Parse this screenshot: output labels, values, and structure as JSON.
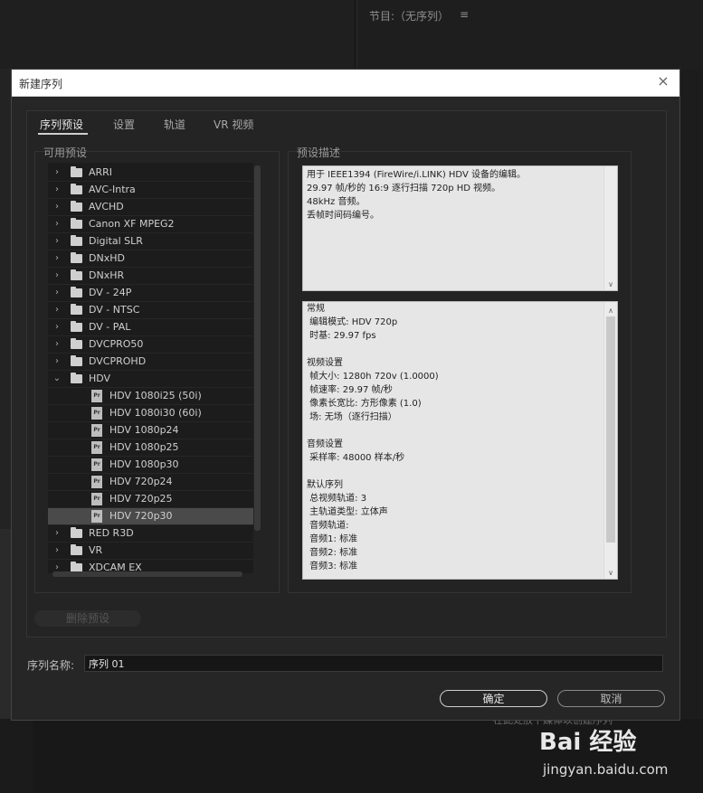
{
  "background": {
    "program_title": "节目:（无序列）",
    "menu_icon": "≡",
    "bottom_text": "在此处放下媒体以创建序列"
  },
  "dialog": {
    "title": "新建序列",
    "close_icon": "×",
    "tabs": [
      {
        "label": "序列预设"
      },
      {
        "label": "设置"
      },
      {
        "label": "轨道"
      },
      {
        "label": "VR 视频"
      }
    ],
    "presets_label": "可用预设",
    "description_label": "预设描述",
    "tree": [
      {
        "label": "ARRI",
        "type": "folder",
        "expanded": false
      },
      {
        "label": "AVC-Intra",
        "type": "folder",
        "expanded": false
      },
      {
        "label": "AVCHD",
        "type": "folder",
        "expanded": false
      },
      {
        "label": "Canon XF MPEG2",
        "type": "folder",
        "expanded": false
      },
      {
        "label": "Digital SLR",
        "type": "folder",
        "expanded": false
      },
      {
        "label": "DNxHD",
        "type": "folder",
        "expanded": false
      },
      {
        "label": "DNxHR",
        "type": "folder",
        "expanded": false
      },
      {
        "label": "DV - 24P",
        "type": "folder",
        "expanded": false
      },
      {
        "label": "DV - NTSC",
        "type": "folder",
        "expanded": false
      },
      {
        "label": "DV - PAL",
        "type": "folder",
        "expanded": false
      },
      {
        "label": "DVCPRO50",
        "type": "folder",
        "expanded": false
      },
      {
        "label": "DVCPROHD",
        "type": "folder",
        "expanded": false
      },
      {
        "label": "HDV",
        "type": "folder",
        "expanded": true
      },
      {
        "label": "HDV 1080i25 (50i)",
        "type": "file"
      },
      {
        "label": "HDV 1080i30 (60i)",
        "type": "file"
      },
      {
        "label": "HDV 1080p24",
        "type": "file"
      },
      {
        "label": "HDV 1080p25",
        "type": "file"
      },
      {
        "label": "HDV 1080p30",
        "type": "file"
      },
      {
        "label": "HDV 720p24",
        "type": "file"
      },
      {
        "label": "HDV 720p25",
        "type": "file"
      },
      {
        "label": "HDV 720p30",
        "type": "file",
        "selected": true
      },
      {
        "label": "RED R3D",
        "type": "folder",
        "expanded": false
      },
      {
        "label": "VR",
        "type": "folder",
        "expanded": false
      },
      {
        "label": "XDCAM EX",
        "type": "folder",
        "expanded": false
      }
    ],
    "description_top": [
      "用于 IEEE1394 (FireWire/i.LINK) HDV 设备的编辑。",
      "29.97 帧/秒的 16:9 逐行扫描 720p HD 视频。",
      "48kHz 音频。",
      "丢帧时间码编号。"
    ],
    "description_bottom": [
      "常规",
      " 编辑模式: HDV 720p",
      " 时基: 29.97 fps",
      "",
      "视频设置",
      " 帧大小: 1280h 720v (1.0000)",
      " 帧速率: 29.97 帧/秒",
      " 像素长宽比: 方形像素 (1.0)",
      " 场: 无场（逐行扫描）",
      "",
      "音频设置",
      " 采样率: 48000 样本/秒",
      "",
      "默认序列",
      " 总视频轨道: 3",
      " 主轨道类型: 立体声",
      " 音频轨道:",
      " 音频1: 标准",
      " 音频2: 标准",
      " 音频3: 标准"
    ],
    "delete_preset_label": "删除预设",
    "sequence_name_label": "序列名称:",
    "sequence_name_value": "序列 01",
    "ok_label": "确定",
    "cancel_label": "取消"
  },
  "watermark": {
    "text": "Bai 经验",
    "url": "jingyan.baidu.com"
  }
}
